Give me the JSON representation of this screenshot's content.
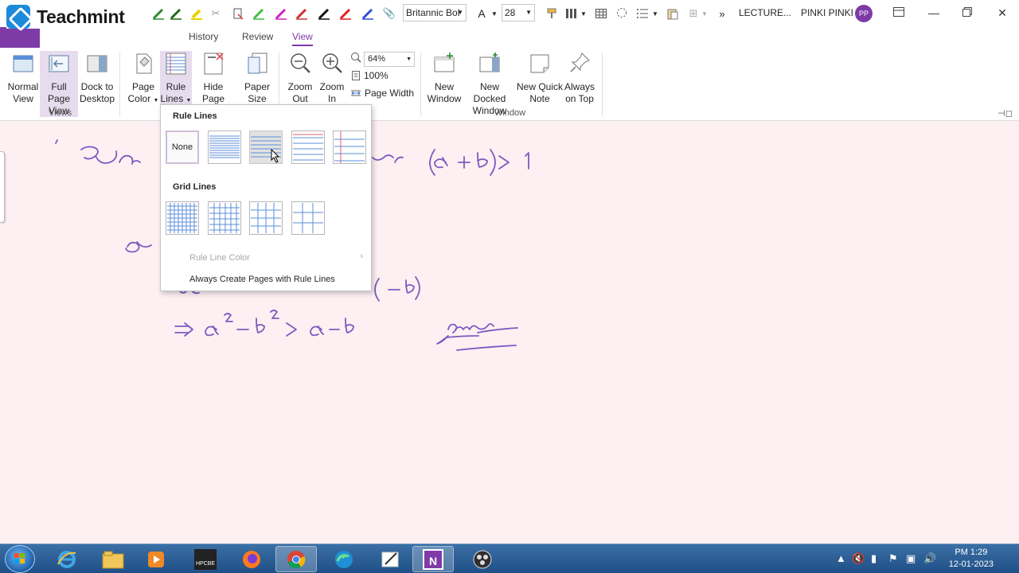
{
  "brand": {
    "name": "Teachmint"
  },
  "quick_access": {
    "font_name": "Britannic Bol",
    "font_size": "28",
    "page_name": "LECTURE...",
    "user_name": "PINKI PINKI",
    "user_initials": "PP"
  },
  "tabs": [
    "History",
    "Review",
    "View"
  ],
  "ribbon": {
    "views": {
      "normal_view": [
        "Normal",
        "View"
      ],
      "full_page_view": [
        "Full Page",
        "View"
      ],
      "dock_to_desktop": [
        "Dock to",
        "Desktop"
      ],
      "group_label": "Views"
    },
    "page_setup": {
      "page_color": [
        "Page",
        "Color"
      ],
      "rule_lines": [
        "Rule",
        "Lines"
      ],
      "hide_page_title": [
        "Hide",
        "Page Title"
      ],
      "paper_size": [
        "Paper",
        "Size"
      ]
    },
    "zoom": {
      "zoom_out": [
        "Zoom",
        "Out"
      ],
      "zoom_in": [
        "Zoom",
        "In"
      ],
      "zoom_value": "64%",
      "hundred_percent": "100%",
      "page_width": "Page Width"
    },
    "window": {
      "new_window": [
        "New",
        "Window"
      ],
      "new_docked_window": [
        "New Docked",
        "Window"
      ],
      "new_quick_note": [
        "New Quick",
        "Note"
      ],
      "always_on_top": [
        "Always",
        "on Top"
      ],
      "group_label": "Window"
    }
  },
  "dropdown": {
    "rule_lines_heading": "Rule Lines",
    "none_label": "None",
    "grid_lines_heading": "Grid Lines",
    "rule_line_color": "Rule Line Color",
    "always_create": "Always Create Pages with Rule Lines"
  },
  "colors": {
    "accent": "#7e3ba7",
    "canvas": "#fdf0f3",
    "ink": "#7b5bbf",
    "rule_blue": "#5b8ed8",
    "rule_red": "#e06070"
  },
  "taskbar": {
    "apps": [
      "ie-icon",
      "explorer-icon",
      "media-player-icon",
      "hpcbe-icon",
      "firefox-icon",
      "chrome-icon",
      "edge-icon",
      "notes-icon",
      "onenote-icon",
      "obs-icon"
    ],
    "hpcbe_label": "HPCBE",
    "onenote_letter": "N",
    "time": "PM 1:29",
    "date": "12-01-2023"
  }
}
